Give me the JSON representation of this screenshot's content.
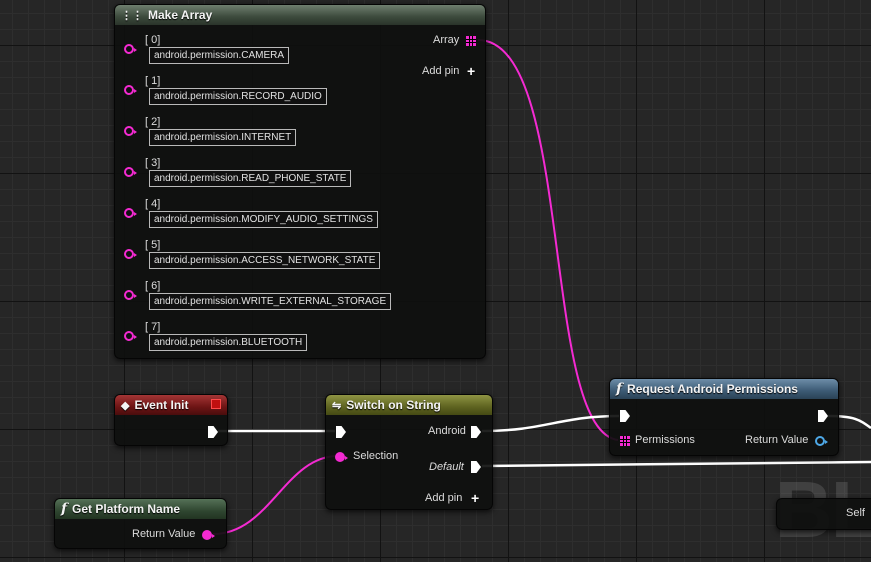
{
  "watermark": "BLU",
  "make_array": {
    "title": "Make Array",
    "output_label": "Array",
    "add_pin_label": "Add pin",
    "items": [
      {
        "index": "[ 0]",
        "value": "android.permission.CAMERA"
      },
      {
        "index": "[ 1]",
        "value": "android.permission.RECORD_AUDIO"
      },
      {
        "index": "[ 2]",
        "value": "android.permission.INTERNET"
      },
      {
        "index": "[ 3]",
        "value": "android.permission.READ_PHONE_STATE"
      },
      {
        "index": "[ 4]",
        "value": "android.permission.MODIFY_AUDIO_SETTINGS"
      },
      {
        "index": "[ 5]",
        "value": "android.permission.ACCESS_NETWORK_STATE"
      },
      {
        "index": "[ 6]",
        "value": "android.permission.WRITE_EXTERNAL_STORAGE"
      },
      {
        "index": "[ 7]",
        "value": "android.permission.BLUETOOTH"
      }
    ]
  },
  "event_init": {
    "title": "Event Init"
  },
  "switch_on_string": {
    "title": "Switch on String",
    "selection_label": "Selection",
    "android_label": "Android",
    "default_label": "Default",
    "add_pin_label": "Add pin"
  },
  "request_permissions": {
    "title": "Request Android Permissions",
    "permissions_label": "Permissions",
    "return_label": "Return Value"
  },
  "get_platform_name": {
    "title": "Get Platform Name",
    "return_label": "Return Value"
  },
  "partial_node": {
    "self_label": "Self"
  },
  "colors": {
    "string_pin": "#f42ad2",
    "exec_pin": "#ffffff",
    "bool_pin": "#4ea9e8",
    "grid_bg": "#262626"
  }
}
